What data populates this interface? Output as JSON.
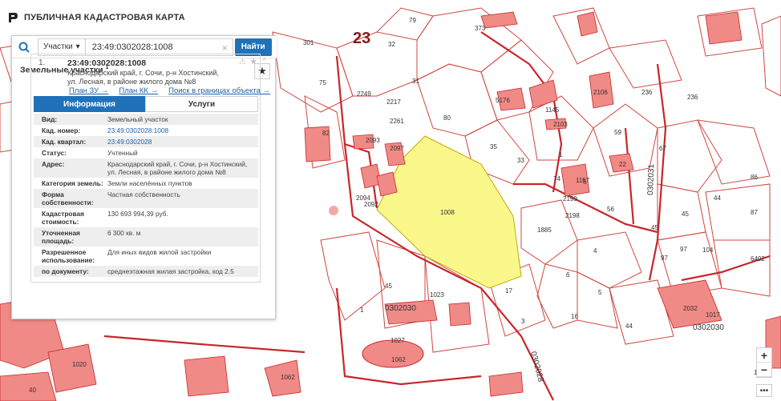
{
  "header": {
    "app_title": "ПУБЛИЧНАЯ КАДАСТРОВАЯ КАРТА"
  },
  "search": {
    "type_label": "Участки",
    "value": "23:49:0302028:1008",
    "find_label": "Найти"
  },
  "section": {
    "title": "Земельные участки",
    "count": "1"
  },
  "card": {
    "index": "1.",
    "number": "23:49:0302028:1008",
    "address": "Краснодарский край, г. Сочи, р-н Хостинский, ул. Лесная, в районе жилого дома №8",
    "links": [
      "План ЗУ →",
      "План КК →",
      "Поиск в границах объекта →"
    ]
  },
  "tabs": {
    "info": "Информация",
    "services": "Услуги"
  },
  "info_rows": [
    {
      "key": "Вид:",
      "value": "Земельный участок"
    },
    {
      "key": "Кад. номер:",
      "value": "23:49:0302028:1008"
    },
    {
      "key": "Кад. квартал:",
      "value": "23:49:0302028"
    },
    {
      "key": "Статус:",
      "value": "Учтенный"
    },
    {
      "key": "Адрес:",
      "value": "Краснодарский край, г. Сочи, р-н Хостинский, ул. Лесная, в районе жилого дома №8"
    },
    {
      "key": "Категория земель:",
      "value": "Земли населённых пунктов"
    },
    {
      "key": "Форма собственности:",
      "value": "Частная собственность"
    },
    {
      "key": "Кадастровая стоимость:",
      "value": "130 693 994,39 руб."
    },
    {
      "key": "Уточненная площадь:",
      "value": "6 300 кв. м"
    },
    {
      "key": "Разрешенное использование:",
      "value": "Для иных видов жилой застройки"
    },
    {
      "key": "по документу:",
      "value": "среднеэтажная жилая застройка, код 2.5"
    }
  ],
  "map": {
    "district_label": "23",
    "highlight_parcel": "1008",
    "quarter_labels": [
      "0302030",
      "0302030",
      "0302028",
      "0302031"
    ],
    "parcel_labels": [
      "301",
      "32",
      "79",
      "373",
      "75",
      "31",
      "2249",
      "2217",
      "2261",
      "80",
      "82",
      "2093",
      "2094",
      "2092",
      "2097",
      "35",
      "33",
      "1",
      "74",
      "1157",
      "22",
      "5",
      "2199",
      "2198",
      "56",
      "59",
      "67",
      "236",
      "236",
      "86",
      "44",
      "87",
      "45",
      "45",
      "97",
      "97",
      "104",
      "6402",
      "1885",
      "4",
      "6",
      "5",
      "16",
      "17",
      "3",
      "44",
      "45",
      "1",
      "1023",
      "1027",
      "1062",
      "1020",
      "1062",
      "40",
      "2032",
      "1017",
      "1145",
      "5176",
      "2106",
      "1028",
      "2103"
    ],
    "zoom_in": "+",
    "zoom_out": "−",
    "more": "•••"
  },
  "colors": {
    "accent": "#1f72b8",
    "parcel_line": "#d0463f",
    "highlight": "#faf78b",
    "building": "#f08a86"
  }
}
